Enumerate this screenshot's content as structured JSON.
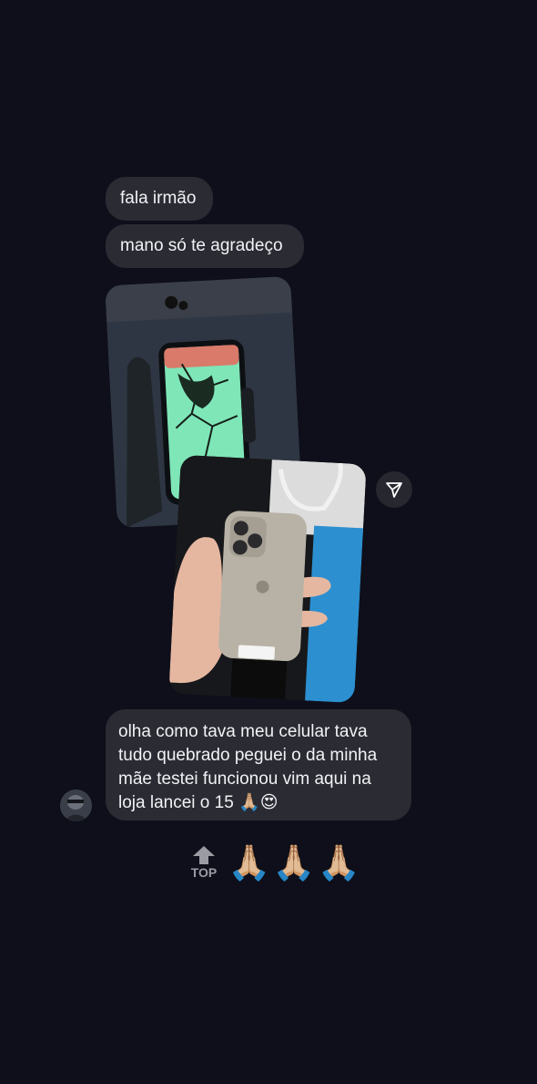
{
  "messages": [
    {
      "text": "fala irmão"
    },
    {
      "text": "mano só te agradeço"
    },
    {
      "text": "olha como tava meu celular tava tudo quebrado peguei o da minha mãe testei funcionou vim aqui na loja lancei o 15 🙏🏼😍"
    }
  ],
  "photos": {
    "back_icon": "cracked-phone-photo",
    "front_icon": "new-iphone-15-photo"
  },
  "share_icon": "paper-plane-icon",
  "reaction": {
    "top_label": "TOP",
    "emojis": [
      "🙏🏼",
      "🙏🏼",
      "🙏🏼"
    ]
  },
  "colors": {
    "background": "#0e0f1a",
    "bubble": "#2a2b33",
    "text": "#f2f2f5"
  }
}
